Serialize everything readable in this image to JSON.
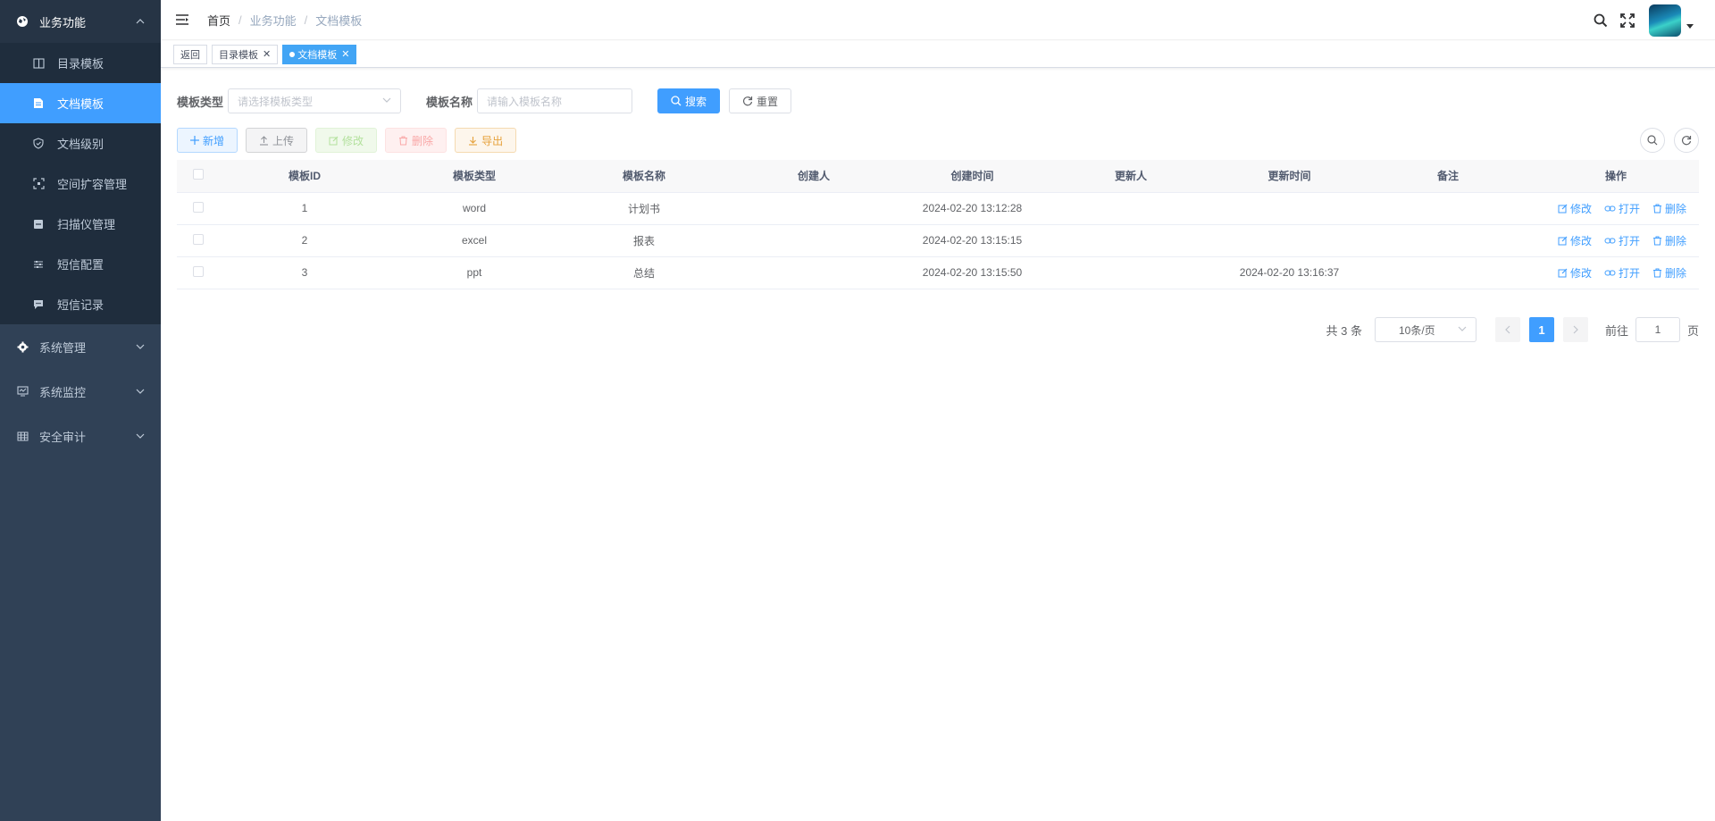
{
  "sidebar": {
    "groups": [
      {
        "label": "业务功能",
        "icon": "globe-icon",
        "expanded": true,
        "items": [
          {
            "label": "目录模板",
            "icon": "book-icon"
          },
          {
            "label": "文档模板",
            "icon": "document-icon",
            "active": true
          },
          {
            "label": "文档级别",
            "icon": "shield-icon"
          },
          {
            "label": "空间扩容管理",
            "icon": "expand-icon"
          },
          {
            "label": "扫描仪管理",
            "icon": "scanner-icon"
          },
          {
            "label": "短信配置",
            "icon": "sliders-icon"
          },
          {
            "label": "短信记录",
            "icon": "message-icon"
          }
        ]
      },
      {
        "label": "系统管理",
        "icon": "gear-icon",
        "expanded": false
      },
      {
        "label": "系统监控",
        "icon": "monitor-icon",
        "expanded": false
      },
      {
        "label": "安全审计",
        "icon": "grid-icon",
        "expanded": false
      }
    ]
  },
  "header": {
    "breadcrumb": [
      "首页",
      "业务功能",
      "文档模板"
    ]
  },
  "tags": {
    "back": "返回",
    "items": [
      {
        "label": "目录模板",
        "active": false
      },
      {
        "label": "文档模板",
        "active": true
      }
    ]
  },
  "search": {
    "type_label": "模板类型",
    "type_placeholder": "请选择模板类型",
    "name_label": "模板名称",
    "name_placeholder": "请输入模板名称",
    "search_button": "搜索",
    "reset_button": "重置"
  },
  "toolbar": {
    "add": "新增",
    "upload": "上传",
    "edit": "修改",
    "delete": "删除",
    "export": "导出"
  },
  "table": {
    "columns": [
      "模板ID",
      "模板类型",
      "模板名称",
      "创建人",
      "创建时间",
      "更新人",
      "更新时间",
      "备注",
      "操作"
    ],
    "rows": [
      {
        "id": "1",
        "type": "word",
        "name": "计划书",
        "creator": "",
        "created": "2024-02-20 13:12:28",
        "updater": "",
        "updated": "",
        "remark": ""
      },
      {
        "id": "2",
        "type": "excel",
        "name": "报表",
        "creator": "",
        "created": "2024-02-20 13:15:15",
        "updater": "",
        "updated": "",
        "remark": ""
      },
      {
        "id": "3",
        "type": "ppt",
        "name": "总结",
        "creator": "",
        "created": "2024-02-20 13:15:50",
        "updater": "",
        "updated": "2024-02-20 13:16:37",
        "remark": ""
      }
    ],
    "actions": {
      "edit": "修改",
      "open": "打开",
      "delete": "删除"
    }
  },
  "pagination": {
    "total": "共 3 条",
    "page_size": "10条/页",
    "current_page": "1",
    "goto_label": "前往",
    "goto_value": "1",
    "page_suffix": "页"
  },
  "colors": {
    "sidebar_bg": "#304156",
    "accent": "#409eff"
  }
}
